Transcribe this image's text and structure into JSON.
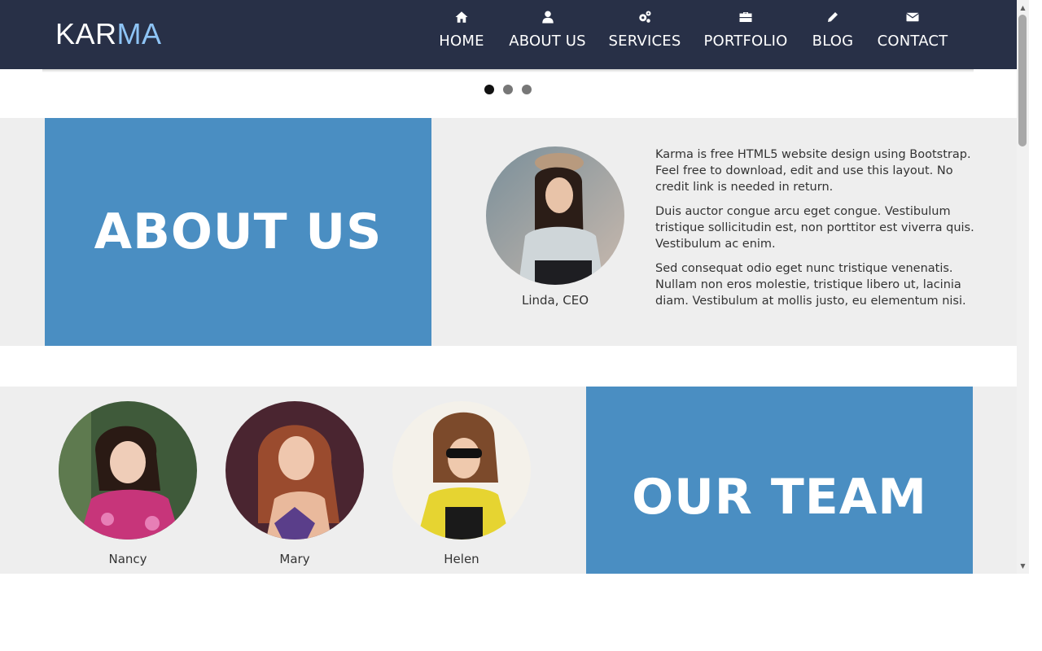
{
  "logo": {
    "part1": "KAR",
    "part2": "MA"
  },
  "nav": [
    {
      "label": "HOME",
      "icon": "home-icon"
    },
    {
      "label": "ABOUT US",
      "icon": "user-icon"
    },
    {
      "label": "SERVICES",
      "icon": "gears-icon"
    },
    {
      "label": "PORTFOLIO",
      "icon": "briefcase-icon"
    },
    {
      "label": "BLOG",
      "icon": "pencil-icon"
    },
    {
      "label": "CONTACT",
      "icon": "envelope-icon"
    }
  ],
  "carousel": {
    "dots": 3,
    "active": 0
  },
  "about": {
    "title": "ABOUT US",
    "ceo_caption": "Linda, CEO",
    "paragraphs": [
      "Karma is free HTML5 website design using Bootstrap. Feel free to download, edit and use this layout. No credit link is needed in return.",
      "Duis auctor congue arcu eget congue. Vestibulum tristique sollicitudin est, non porttitor est viverra quis. Vestibulum ac enim.",
      "Sed consequat odio eget nunc tristique venenatis. Nullam non eros molestie, tristique libero ut, lacinia diam. Vestibulum at mollis justo, eu elementum nisi."
    ]
  },
  "team": {
    "title": "OUR TEAM",
    "members": [
      {
        "name": "Nancy"
      },
      {
        "name": "Mary"
      },
      {
        "name": "Helen"
      }
    ]
  },
  "colors": {
    "header_bg": "#283047",
    "accent_blue": "#4a8ec2",
    "logo_accent": "#8ec4f5",
    "band_gray": "#eeeeee"
  }
}
